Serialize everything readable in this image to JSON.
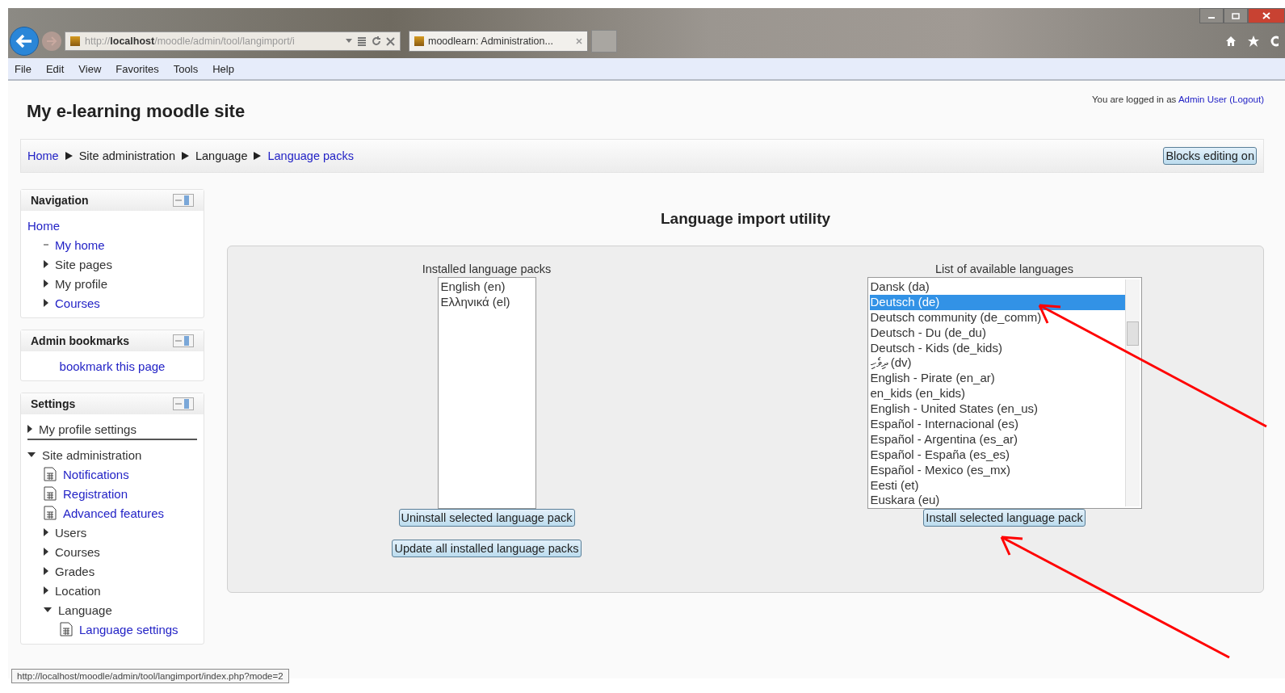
{
  "browser": {
    "address": "http://**localhost**/moodle/admin/tool/langimport/i",
    "tabs": [
      {
        "title": "moodlearn: Administration...",
        "selected": true
      }
    ],
    "menu": [
      "File",
      "Edit",
      "View",
      "Favorites",
      "Tools",
      "Help"
    ],
    "status_url": "http://localhost/moodle/admin/tool/langimport/index.php?mode=2"
  },
  "header": {
    "site_title": "My e-learning moodle site",
    "login_prefix": "You are logged in as",
    "login_user": "Admin User",
    "logout": "(Logout)"
  },
  "breadcrumb": [
    {
      "label": "Home",
      "link": true
    },
    {
      "label": "Site administration",
      "link": false
    },
    {
      "label": "Language",
      "link": false
    },
    {
      "label": "Language packs",
      "link": true
    }
  ],
  "blocks_button": "Blocks editing on",
  "sidebar": [
    {
      "title": "Navigation",
      "items": [
        {
          "label": "Home",
          "link": true,
          "kind": "plain",
          "children": [
            {
              "label": "My home",
              "link": true,
              "kind": "leaf"
            },
            {
              "label": "Site pages",
              "link": false,
              "kind": "collapsed"
            },
            {
              "label": "My profile",
              "link": false,
              "kind": "collapsed"
            },
            {
              "label": "Courses",
              "link": true,
              "kind": "collapsed"
            }
          ]
        }
      ]
    },
    {
      "title": "Admin bookmarks",
      "items": [
        {
          "label": "bookmark this page",
          "link": true,
          "kind": "centered"
        }
      ]
    },
    {
      "title": "Settings",
      "items": [
        {
          "label": "My profile settings",
          "link": false,
          "kind": "collapsed",
          "divider": true
        },
        {
          "label": "Site administration",
          "link": false,
          "kind": "expanded",
          "children": [
            {
              "label": "Notifications",
              "link": true,
              "kind": "page"
            },
            {
              "label": "Registration",
              "link": true,
              "kind": "page"
            },
            {
              "label": "Advanced features",
              "link": true,
              "kind": "page"
            },
            {
              "label": "Users",
              "link": false,
              "kind": "collapsed"
            },
            {
              "label": "Courses",
              "link": false,
              "kind": "collapsed"
            },
            {
              "label": "Grades",
              "link": false,
              "kind": "collapsed"
            },
            {
              "label": "Location",
              "link": false,
              "kind": "collapsed"
            },
            {
              "label": "Language",
              "link": false,
              "kind": "expanded",
              "children": [
                {
                  "label": "Language settings",
                  "link": true,
                  "kind": "page"
                }
              ]
            }
          ]
        }
      ]
    }
  ],
  "main": {
    "heading": "Language import utility",
    "installed": {
      "label": "Installed language packs",
      "options": [
        {
          "label": "English (en)",
          "selected": false
        },
        {
          "label": "Ελληνικά (el)",
          "selected": false
        }
      ],
      "buttons": [
        "Uninstall selected language pack",
        "Update all installed language packs"
      ]
    },
    "available": {
      "label": "List of available languages",
      "options": [
        {
          "label": "Dansk (da)",
          "selected": false
        },
        {
          "label": "Deutsch (de)",
          "selected": true
        },
        {
          "label": "Deutsch community (de_comm)",
          "selected": false
        },
        {
          "label": "Deutsch - Du (de_du)",
          "selected": false
        },
        {
          "label": "Deutsch - Kids (de_kids)",
          "selected": false
        },
        {
          "label": "ދިވެހި (dv)",
          "selected": false
        },
        {
          "label": "English - Pirate (en_ar)",
          "selected": false
        },
        {
          "label": "en_kids (en_kids)",
          "selected": false
        },
        {
          "label": "English - United States (en_us)",
          "selected": false
        },
        {
          "label": "Español - Internacional (es)",
          "selected": false
        },
        {
          "label": "Español - Argentina (es_ar)",
          "selected": false
        },
        {
          "label": "Español - España (es_es)",
          "selected": false
        },
        {
          "label": "Español - Mexico (es_mx)",
          "selected": false
        },
        {
          "label": "Eesti (et)",
          "selected": false
        },
        {
          "label": "Euskara (eu)",
          "selected": false
        }
      ],
      "buttons": [
        "Install selected language pack"
      ]
    }
  }
}
